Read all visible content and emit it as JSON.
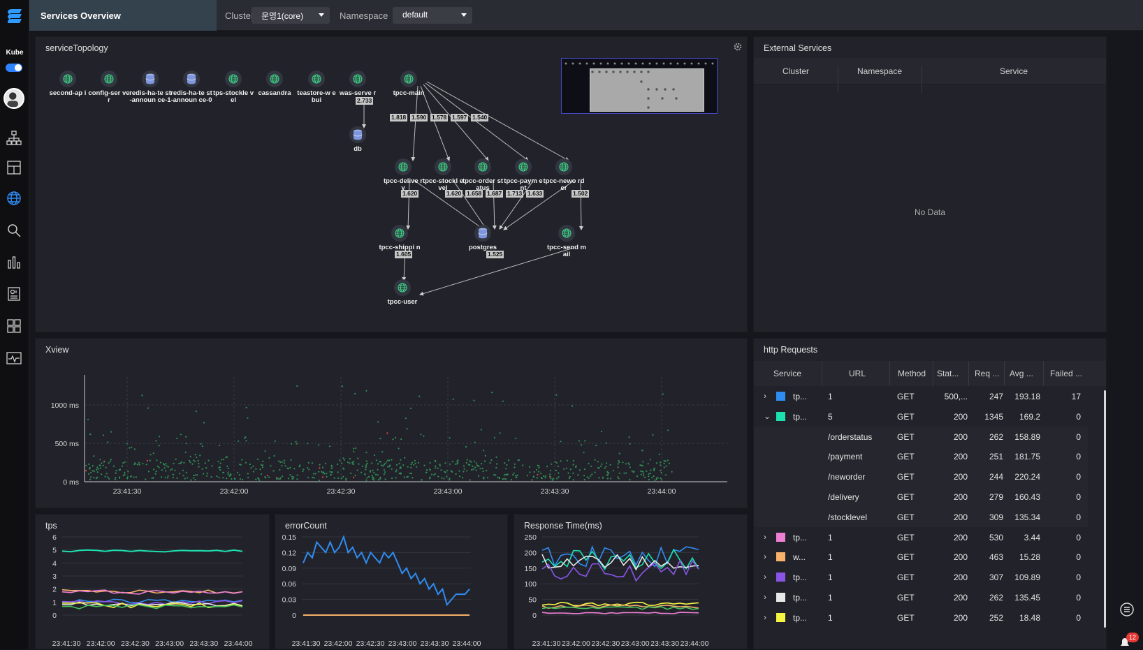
{
  "sidebar": {
    "kube_label": "Kube",
    "icons": [
      "logo-icon",
      "topology-icon",
      "layout-icon",
      "globe-icon",
      "search-icon",
      "bar-chart-icon",
      "report-icon",
      "grid-icon",
      "monitor-icon"
    ]
  },
  "header": {
    "title": "Services Overview",
    "cluster_label": "Cluster",
    "cluster_value": "운영1(core)",
    "namespace_label": "Namespace",
    "namespace_value": "default"
  },
  "topology": {
    "title": "serviceTopology",
    "nodes": [
      {
        "id": "second-api",
        "label": "second-ap i",
        "type": "web"
      },
      {
        "id": "config-server",
        "label": "config-ser ver",
        "type": "web"
      },
      {
        "id": "redis-1",
        "label": "redis-ha-te st-announ ce-1",
        "type": "db"
      },
      {
        "id": "redis-0",
        "label": "redis-ha-te st-announ ce-0",
        "type": "db"
      },
      {
        "id": "tps-stocklevel",
        "label": "tps-stockle vel",
        "type": "web"
      },
      {
        "id": "cassandra",
        "label": "cassandra",
        "type": "web"
      },
      {
        "id": "teastore",
        "label": "teastore-w ebui",
        "type": "web"
      },
      {
        "id": "was-server",
        "label": "was-serve r",
        "type": "web"
      },
      {
        "id": "db",
        "label": "db",
        "type": "db"
      },
      {
        "id": "tpcc-main",
        "label": "tpcc-main",
        "type": "web"
      },
      {
        "id": "tpcc-delivery",
        "label": "tpcc-delive ry",
        "type": "web"
      },
      {
        "id": "tpcc-stocklevel",
        "label": "tpcc-stockl evel",
        "type": "web"
      },
      {
        "id": "tpcc-orderstatus",
        "label": "tpcc-order status",
        "type": "web"
      },
      {
        "id": "tpcc-payment",
        "label": "tpcc-paym ent",
        "type": "web"
      },
      {
        "id": "tpcc-neworder",
        "label": "tpcc-newo rder",
        "type": "web"
      },
      {
        "id": "tpcc-shipping",
        "label": "tpcc-shippi ng",
        "type": "web"
      },
      {
        "id": "postgres",
        "label": "postgres",
        "type": "db"
      },
      {
        "id": "tpcc-sendmail",
        "label": "tpcc-send mail",
        "type": "web"
      },
      {
        "id": "tpcc-user",
        "label": "tpcc-user",
        "type": "web"
      }
    ],
    "edge_labels": [
      "2.733",
      "1.818",
      "1.590",
      "1.578",
      "1.597",
      "1.540",
      "1.620",
      "1.620",
      "1.658",
      "1.687",
      "1.713",
      "1.633",
      "1.502",
      "1.605",
      "1.525"
    ]
  },
  "external_services": {
    "title": "External Services",
    "columns": [
      "Cluster",
      "Namespace",
      "Service"
    ],
    "empty_text": "No Data"
  },
  "xview": {
    "title": "Xview",
    "y_ticks": [
      "1000 ms",
      "500 ms",
      "0 ms"
    ],
    "x_ticks": [
      "23:41:30",
      "23:42:00",
      "23:42:30",
      "23:43:00",
      "23:43:30",
      "23:44:00"
    ]
  },
  "http_requests": {
    "title": "http Requests",
    "columns": [
      "Service",
      "URL",
      "Method",
      "Stat...",
      "Req ...",
      "Avg ...",
      "Failed ..."
    ],
    "rows": [
      {
        "expanded": false,
        "color": "#2f8cf2",
        "service": "tp...",
        "url": "1",
        "method": "GET",
        "status": "500,...",
        "req": "247",
        "avg": "193.18",
        "failed": "17"
      },
      {
        "expanded": true,
        "color": "#1de0b0",
        "service": "tp...",
        "url": "5",
        "method": "GET",
        "status": "200",
        "req": "1345",
        "avg": "169.2",
        "failed": "0"
      },
      {
        "child": true,
        "url": "/orderstatus",
        "method": "GET",
        "status": "200",
        "req": "262",
        "avg": "158.89",
        "failed": "0"
      },
      {
        "child": true,
        "url": "/payment",
        "method": "GET",
        "status": "200",
        "req": "251",
        "avg": "181.75",
        "failed": "0"
      },
      {
        "child": true,
        "url": "/neworder",
        "method": "GET",
        "status": "200",
        "req": "244",
        "avg": "220.24",
        "failed": "0"
      },
      {
        "child": true,
        "url": "/delivery",
        "method": "GET",
        "status": "200",
        "req": "279",
        "avg": "160.43",
        "failed": "0"
      },
      {
        "child": true,
        "url": "/stocklevel",
        "method": "GET",
        "status": "200",
        "req": "309",
        "avg": "135.34",
        "failed": "0"
      },
      {
        "expanded": false,
        "color": "#ee80d4",
        "service": "tp...",
        "url": "1",
        "method": "GET",
        "status": "200",
        "req": "530",
        "avg": "3.44",
        "failed": "0"
      },
      {
        "expanded": false,
        "color": "#f7b16a",
        "service": "w...",
        "url": "1",
        "method": "GET",
        "status": "200",
        "req": "463",
        "avg": "15.28",
        "failed": "0"
      },
      {
        "expanded": false,
        "color": "#8a55e6",
        "service": "tp...",
        "url": "1",
        "method": "GET",
        "status": "200",
        "req": "307",
        "avg": "109.89",
        "failed": "0"
      },
      {
        "expanded": false,
        "color": "#e8e8e8",
        "service": "tp...",
        "url": "1",
        "method": "GET",
        "status": "200",
        "req": "262",
        "avg": "135.45",
        "failed": "0"
      },
      {
        "expanded": false,
        "color": "#f5f542",
        "service": "tp...",
        "url": "1",
        "method": "GET",
        "status": "200",
        "req": "252",
        "avg": "18.48",
        "failed": "0"
      }
    ]
  },
  "tps_chart": {
    "title": "tps",
    "y_ticks": [
      "6",
      "5",
      "4",
      "3",
      "2",
      "1",
      "0"
    ],
    "x_ticks": [
      "23:41:30",
      "23:42:00",
      "23:42:30",
      "23:43:00",
      "23:43:30",
      "23:44:00"
    ]
  },
  "error_chart": {
    "title": "errorCount",
    "y_ticks": [
      "0.15",
      "0.12",
      "0.09",
      "0.06",
      "0.03",
      "0"
    ],
    "x_ticks": [
      "23:41:30",
      "23:42:00",
      "23:42:30",
      "23:43:00",
      "23:43:30",
      "23:44:00"
    ]
  },
  "response_chart": {
    "title": "Response Time(ms)",
    "y_ticks": [
      "250",
      "200",
      "150",
      "100",
      "50",
      "0"
    ],
    "x_ticks": [
      "23:41:30",
      "23:42:00",
      "23:42:30",
      "23:43:00",
      "23:43:30",
      "23:44:00"
    ]
  },
  "notifications": {
    "count": "12"
  }
}
